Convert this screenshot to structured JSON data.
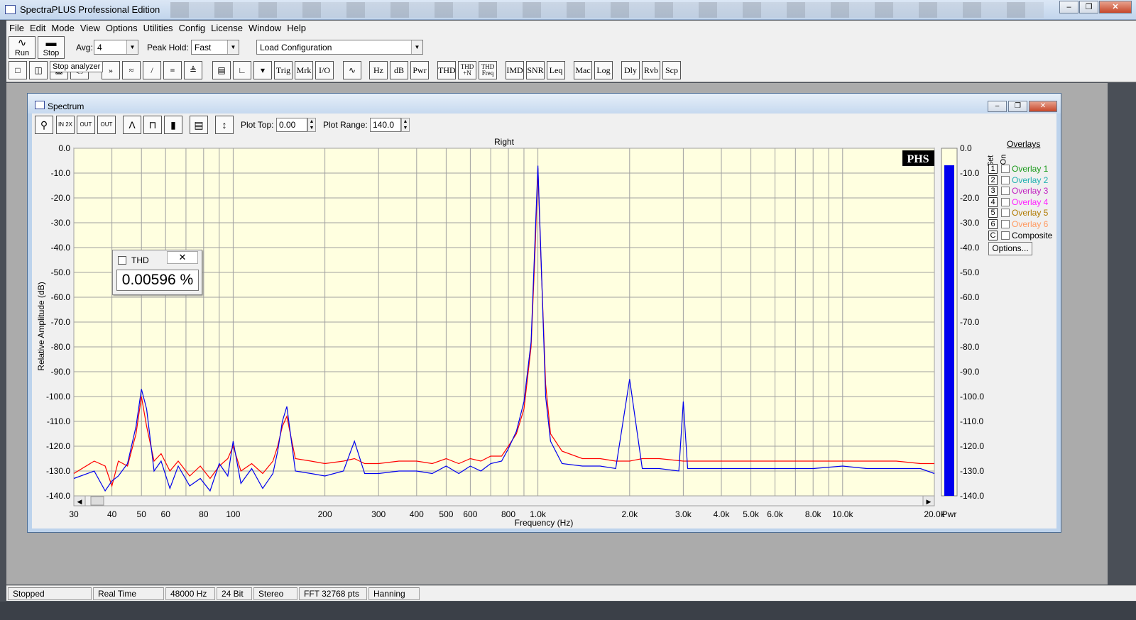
{
  "app": {
    "title": "SpectraPLUS Professional Edition"
  },
  "menu": [
    "File",
    "Edit",
    "Mode",
    "View",
    "Options",
    "Utilities",
    "Config",
    "License",
    "Window",
    "Help"
  ],
  "toolbar1": {
    "run_label": "Run",
    "stop_label": "Stop",
    "avg_label": "Avg:",
    "avg_value": "4",
    "peak_hold_label": "Peak Hold:",
    "peak_hold_value": "Fast",
    "config_value": "Load Configuration",
    "tooltip": "Stop analyzer"
  },
  "toolbar2": {
    "text_buttons": [
      "Trig",
      "Mrk",
      "I/O",
      "Hz",
      "dB",
      "Pwr",
      "THD",
      "THD +N",
      "THD Freq",
      "IMD",
      "SNR",
      "Leq",
      "Mac",
      "Log",
      "Dly",
      "Rvb",
      "Scp"
    ]
  },
  "chart_window": {
    "title": "Spectrum",
    "plot_top_label": "Plot Top:",
    "plot_top_value": "0.00",
    "plot_range_label": "Plot Range:",
    "plot_range_value": "140.0",
    "channel_title": "Right",
    "logo": "PHS",
    "pwr_label": "Pwr"
  },
  "thd_popup": {
    "title": "THD",
    "value": "0.00596 %"
  },
  "overlays": {
    "header": "Overlays",
    "set_label": "Set",
    "on_label": "On",
    "items": [
      {
        "num": "1",
        "name": "Overlay 1",
        "color": "#1a9a1a"
      },
      {
        "num": "2",
        "name": "Overlay 2",
        "color": "#20b0b0"
      },
      {
        "num": "3",
        "name": "Overlay 3",
        "color": "#c020c0"
      },
      {
        "num": "4",
        "name": "Overlay 4",
        "color": "#ff20ff"
      },
      {
        "num": "5",
        "name": "Overlay 5",
        "color": "#b07a00"
      },
      {
        "num": "6",
        "name": "Overlay 6",
        "color": "#ff9a60"
      },
      {
        "num": "C",
        "name": "Composite",
        "color": "#000000"
      }
    ],
    "options_label": "Options..."
  },
  "status": [
    "Stopped",
    "Real Time",
    "48000 Hz",
    "24 Bit",
    "Stereo",
    "FFT 32768 pts",
    "Hanning"
  ],
  "chart_data": {
    "type": "line",
    "title": "Right",
    "xlabel": "Frequency (Hz)",
    "ylabel": "Relative Amplitude (dB)",
    "xscale": "log",
    "xlim": [
      30,
      20000
    ],
    "ylim": [
      -140,
      0
    ],
    "grid": true,
    "x_ticks": [
      30,
      40,
      50,
      60,
      80,
      100,
      200,
      300,
      400,
      500,
      600,
      800,
      1000,
      2000,
      3000,
      4000,
      5000,
      6000,
      8000,
      10000,
      20000
    ],
    "x_tick_labels": [
      "30",
      "40",
      "50",
      "60",
      "80",
      "100",
      "200",
      "300",
      "400",
      "500",
      "600",
      "800",
      "1.0k",
      "2.0k",
      "3.0k",
      "4.0k",
      "5.0k",
      "6.0k",
      "8.0k",
      "10.0k",
      "20.0k"
    ],
    "y_ticks": [
      0,
      -10,
      -20,
      -30,
      -40,
      -50,
      -60,
      -70,
      -80,
      -90,
      -100,
      -110,
      -120,
      -130,
      -140
    ],
    "y_tick_labels": [
      "0.0",
      "-10.0",
      "-20.0",
      "-30.0",
      "-40.0",
      "-50.0",
      "-60.0",
      "-70.0",
      "-80.0",
      "-90.0",
      "-100.0",
      "-110.0",
      "-120.0",
      "-130.0",
      "-140.0"
    ],
    "series": [
      {
        "color": "#ff0000",
        "x": [
          30,
          35,
          38,
          40,
          42,
          45,
          48,
          50,
          52,
          55,
          58,
          62,
          66,
          72,
          78,
          84,
          90,
          96,
          100,
          106,
          115,
          125,
          135,
          140,
          145,
          150,
          160,
          180,
          200,
          230,
          250,
          270,
          300,
          350,
          400,
          450,
          500,
          550,
          600,
          650,
          700,
          760,
          800,
          850,
          900,
          950,
          980,
          1000,
          1020,
          1060,
          1100,
          1200,
          1400,
          1600,
          1800,
          2000,
          2200,
          2500,
          3000,
          3500,
          4000,
          5000,
          6000,
          8000,
          10000,
          12000,
          15000,
          18000,
          20000
        ],
        "y": [
          -131,
          -126,
          -128,
          -136,
          -126,
          -128,
          -115,
          -100,
          -112,
          -126,
          -123,
          -130,
          -126,
          -132,
          -128,
          -133,
          -128,
          -125,
          -120,
          -130,
          -127,
          -131,
          -126,
          -120,
          -112,
          -108,
          -125,
          -126,
          -127,
          -126,
          -125,
          -127,
          -127,
          -126,
          -126,
          -127,
          -125,
          -127,
          -125,
          -126,
          -124,
          -124,
          -120,
          -115,
          -105,
          -80,
          -40,
          -8,
          -40,
          -95,
          -115,
          -122,
          -125,
          -125,
          -126,
          -126,
          -125,
          -125,
          -126,
          -126,
          -126,
          -126,
          -126,
          -126,
          -126,
          -126,
          -126,
          -127,
          -127
        ]
      },
      {
        "color": "#0000ee",
        "x": [
          30,
          35,
          38,
          40,
          42,
          45,
          48,
          50,
          52,
          55,
          58,
          62,
          66,
          72,
          78,
          84,
          90,
          96,
          100,
          106,
          115,
          125,
          135,
          140,
          145,
          150,
          160,
          180,
          200,
          230,
          250,
          270,
          300,
          350,
          400,
          450,
          500,
          550,
          600,
          650,
          700,
          760,
          800,
          850,
          900,
          950,
          980,
          1000,
          1020,
          1060,
          1100,
          1200,
          1400,
          1600,
          1800,
          2000,
          2200,
          2500,
          2900,
          3000,
          3100,
          3500,
          4000,
          5000,
          6000,
          8000,
          10000,
          12000,
          15000,
          18000,
          20000
        ],
        "y": [
          -133,
          -130,
          -138,
          -134,
          -132,
          -127,
          -112,
          -97,
          -105,
          -130,
          -126,
          -137,
          -128,
          -136,
          -133,
          -138,
          -127,
          -132,
          -118,
          -135,
          -129,
          -137,
          -131,
          -122,
          -110,
          -104,
          -130,
          -131,
          -132,
          -130,
          -118,
          -131,
          -131,
          -130,
          -130,
          -131,
          -128,
          -131,
          -128,
          -130,
          -127,
          -126,
          -121,
          -114,
          -102,
          -78,
          -35,
          -7,
          -38,
          -100,
          -118,
          -127,
          -128,
          -128,
          -129,
          -93,
          -129,
          -129,
          -130,
          -102,
          -129,
          -129,
          -129,
          -129,
          -129,
          -129,
          -128,
          -129,
          -129,
          -129,
          -131
        ]
      }
    ]
  }
}
